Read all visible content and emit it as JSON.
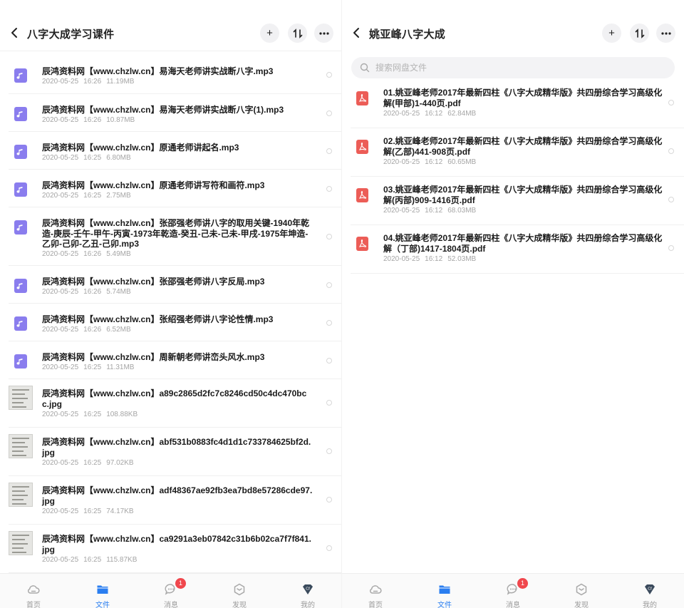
{
  "left": {
    "title": "八字大成学习课件",
    "files": [
      {
        "name": "辰鸿资料网【www.chzlw.cn】易海天老师讲实战断八字.mp3",
        "date": "2020-05-25",
        "time": "16:26",
        "size": "11.19MB",
        "type": "audio"
      },
      {
        "name": "辰鸿资料网【www.chzlw.cn】易海天老师讲实战断八字(1).mp3",
        "date": "2020-05-25",
        "time": "16:26",
        "size": "10.87MB",
        "type": "audio"
      },
      {
        "name": "辰鸿资料网【www.chzlw.cn】原通老师讲起名.mp3",
        "date": "2020-05-25",
        "time": "16:25",
        "size": "6.80MB",
        "type": "audio"
      },
      {
        "name": "辰鸿资料网【www.chzlw.cn】原通老师讲写符和画符.mp3",
        "date": "2020-05-25",
        "time": "16:25",
        "size": "2.75MB",
        "type": "audio"
      },
      {
        "name": "辰鸿资料网【www.chzlw.cn】张邵强老师讲八字的取用关键-1940年乾造-庚辰-壬午-甲午-丙寅-1973年乾造-癸丑-己未-己未-甲戌-1975年坤造-乙卯-己卯-乙丑-己卯.mp3",
        "date": "2020-05-25",
        "time": "16:26",
        "size": "5.49MB",
        "type": "audio"
      },
      {
        "name": "辰鸿资料网【www.chzlw.cn】张邵强老师讲八字反局.mp3",
        "date": "2020-05-25",
        "time": "16:26",
        "size": "5.74MB",
        "type": "audio"
      },
      {
        "name": "辰鸿资料网【www.chzlw.cn】张绍强老师讲八字论性情.mp3",
        "date": "2020-05-25",
        "time": "16:26",
        "size": "6.52MB",
        "type": "audio"
      },
      {
        "name": "辰鸿资料网【www.chzlw.cn】周新朝老师讲峦头风水.mp3",
        "date": "2020-05-25",
        "time": "16:25",
        "size": "11.31MB",
        "type": "audio"
      },
      {
        "name": "辰鸿资料网【www.chzlw.cn】a89c2865d2fc7c8246cd50c4dc470bcc.jpg",
        "date": "2020-05-25",
        "time": "16:25",
        "size": "108.88KB",
        "type": "image"
      },
      {
        "name": "辰鸿资料网【www.chzlw.cn】abf531b0883fc4d1d1c733784625bf2d.jpg",
        "date": "2020-05-25",
        "time": "16:25",
        "size": "97.02KB",
        "type": "image"
      },
      {
        "name": "辰鸿资料网【www.chzlw.cn】adf48367ae92fb3ea7bd8e57286cde97.jpg",
        "date": "2020-05-25",
        "time": "16:25",
        "size": "74.17KB",
        "type": "image"
      },
      {
        "name": "辰鸿资料网【www.chzlw.cn】ca9291a3eb07842c31b6b02ca7f7f841.jpg",
        "date": "2020-05-25",
        "time": "16:25",
        "size": "115.87KB",
        "type": "image"
      }
    ]
  },
  "right": {
    "title": "姚亚峰八字大成",
    "search_placeholder": "搜索网盘文件",
    "files": [
      {
        "name": "01.姚亚峰老师2017年最新四柱《八字大成精华版》共四册综合学习高级化解(甲部)1-440页.pdf",
        "date": "2020-05-25",
        "time": "16:12",
        "size": "62.84MB",
        "type": "pdf"
      },
      {
        "name": "02.姚亚峰老师2017年最新四柱《八字大成精华版》共四册综合学习高级化解(乙部)441-908页.pdf",
        "date": "2020-05-25",
        "time": "16:12",
        "size": "60.65MB",
        "type": "pdf"
      },
      {
        "name": "03.姚亚峰老师2017年最新四柱《八字大成精华版》共四册综合学习高级化解(丙部)909-1416页.pdf",
        "date": "2020-05-25",
        "time": "16:12",
        "size": "68.03MB",
        "type": "pdf"
      },
      {
        "name": "04.姚亚峰老师2017年最新四柱《八字大成精华版》共四册综合学习高级化解（丁部)1417-1804页.pdf",
        "date": "2020-05-25",
        "time": "16:12",
        "size": "52.03MB",
        "type": "pdf"
      }
    ]
  },
  "tabs": [
    {
      "label": "首页",
      "icon": "cloud-icon",
      "active": false
    },
    {
      "label": "文件",
      "icon": "folder-icon",
      "active": true
    },
    {
      "label": "消息",
      "icon": "chat-icon",
      "active": false,
      "badge": "1"
    },
    {
      "label": "发现",
      "icon": "discover-icon",
      "active": false
    },
    {
      "label": "我的",
      "icon": "profile-icon",
      "active": false
    }
  ],
  "colors": {
    "accent": "#2a7ef0",
    "audio_icon": "#8a7dee",
    "pdf_icon": "#ec5d57",
    "badge": "#f0474d"
  }
}
